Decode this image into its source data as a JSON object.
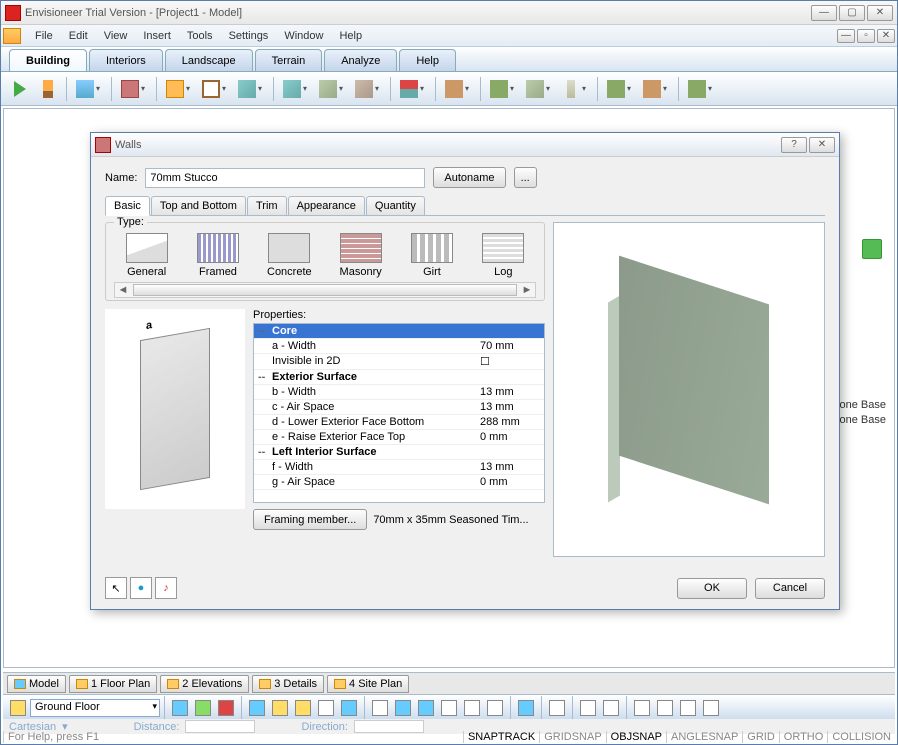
{
  "title": "Envisioneer Trial Version - [Project1 - Model]",
  "menu": [
    "File",
    "Edit",
    "View",
    "Insert",
    "Tools",
    "Settings",
    "Window",
    "Help"
  ],
  "tabs": [
    "Building",
    "Interiors",
    "Landscape",
    "Terrain",
    "Analyze",
    "Help"
  ],
  "side_items": [
    "Stone Base",
    "Stone Base"
  ],
  "viewtabs": [
    {
      "label": "Model",
      "icon": "b"
    },
    {
      "label": "1 Floor Plan",
      "icon": "y"
    },
    {
      "label": "2 Elevations",
      "icon": "y"
    },
    {
      "label": "3 Details",
      "icon": "y"
    },
    {
      "label": "4 Site Plan",
      "icon": "y"
    }
  ],
  "floor_combo": "Ground Floor",
  "status_left": {
    "coord": "Cartesian",
    "dist": "Distance:",
    "dir": "Direction:"
  },
  "status_help": "For Help, press F1",
  "status_flags": [
    "SNAPTRACK",
    "GRIDSNAP",
    "OBJSNAP",
    "ANGLESNAP",
    "GRID",
    "ORTHO",
    "COLLISION"
  ],
  "status_active": [
    0,
    2
  ],
  "dialog": {
    "title": "Walls",
    "name_label": "Name:",
    "name_value": "70mm Stucco",
    "autoname": "Autoname",
    "dots": "...",
    "tabs": [
      "Basic",
      "Top and Bottom",
      "Trim",
      "Appearance",
      "Quantity"
    ],
    "type_label": "Type:",
    "types": [
      "General",
      "Framed",
      "Concrete",
      "Masonry",
      "Girt",
      "Log"
    ],
    "props_label": "Properties:",
    "props": [
      {
        "t": "--",
        "k": "Core",
        "v": "",
        "hd": true,
        "sel": true
      },
      {
        "t": "",
        "k": "a - Width",
        "v": "70 mm"
      },
      {
        "t": "",
        "k": "Invisible in 2D",
        "v": "☐"
      },
      {
        "t": "--",
        "k": "Exterior Surface",
        "v": "",
        "hd": true
      },
      {
        "t": "",
        "k": "b - Width",
        "v": "13 mm"
      },
      {
        "t": "",
        "k": "c - Air Space",
        "v": "13 mm"
      },
      {
        "t": "",
        "k": "d - Lower Exterior Face Bottom",
        "v": "288 mm"
      },
      {
        "t": "",
        "k": "e - Raise Exterior Face Top",
        "v": "0 mm"
      },
      {
        "t": "--",
        "k": "Left Interior Surface",
        "v": "",
        "hd": true
      },
      {
        "t": "",
        "k": "f - Width",
        "v": "13 mm"
      },
      {
        "t": "",
        "k": "g - Air Space",
        "v": "0 mm"
      }
    ],
    "framing_btn": "Framing member...",
    "framing_val": "70mm x 35mm Seasoned Tim...",
    "ok": "OK",
    "cancel": "Cancel"
  }
}
